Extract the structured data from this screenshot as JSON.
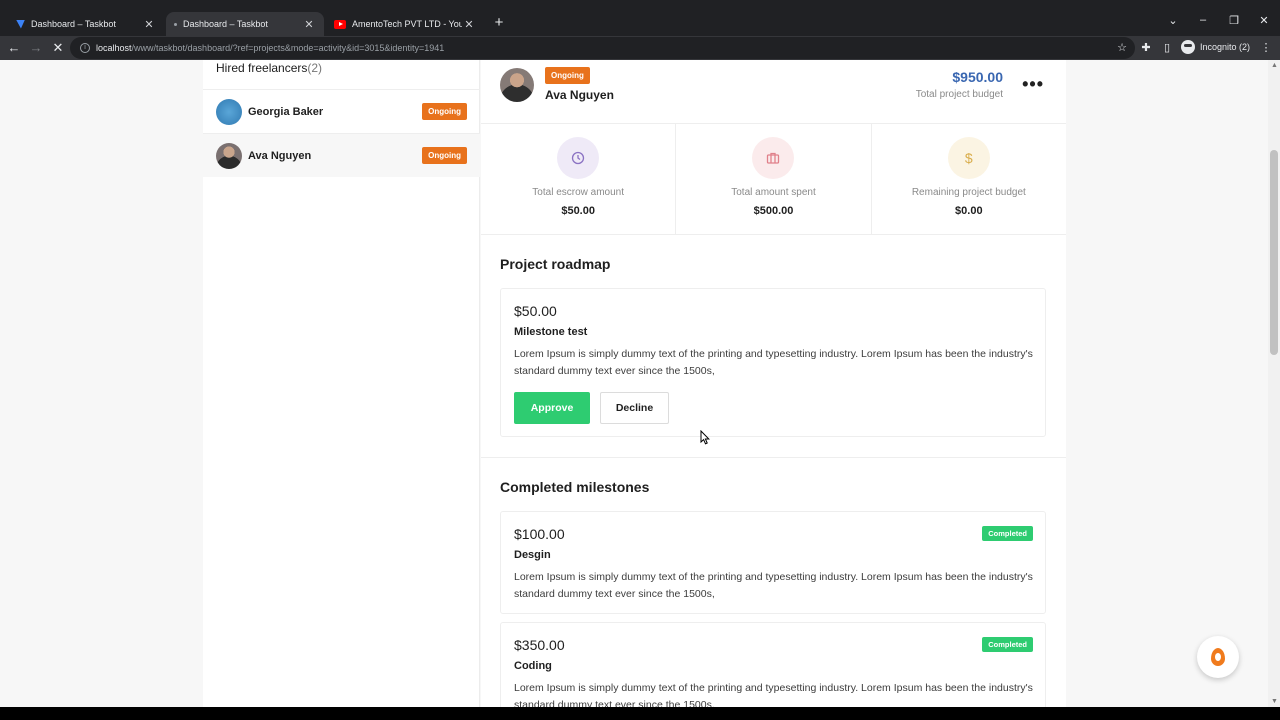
{
  "browser": {
    "tabs": [
      {
        "label": "Dashboard – Taskbot",
        "favicon": "taskbot-icon"
      },
      {
        "label": "Dashboard – Taskbot",
        "favicon": "loading-icon"
      },
      {
        "label": "AmentoTech PVT LTD - YouTube",
        "favicon": "youtube-icon"
      }
    ],
    "url_host": "localhost",
    "url_path": "/www/taskbot/dashboard/?ref=projects&mode=activity&id=3015&identity=1941",
    "profile_label": "Incognito (2)"
  },
  "sidebar": {
    "title": "Hired freelancers",
    "count": "(2)",
    "freelancers": [
      {
        "name": "Georgia Baker",
        "status": "Ongoing"
      },
      {
        "name": "Ava Nguyen",
        "status": "Ongoing"
      }
    ]
  },
  "header": {
    "status": "Ongoing",
    "name": "Ava Nguyen",
    "budget": "$950.00",
    "budget_label": "Total project budget"
  },
  "stats": [
    {
      "label": "Total escrow amount",
      "value": "$50.00",
      "icon": "clock-icon",
      "color": "#8b72c3"
    },
    {
      "label": "Total amount spent",
      "value": "$500.00",
      "icon": "briefcase-icon",
      "color": "#e0808a"
    },
    {
      "label": "Remaining project budget",
      "value": "$0.00",
      "icon": "dollar-icon",
      "color": "#d9ad4c"
    }
  ],
  "roadmap": {
    "title": "Project roadmap",
    "milestone": {
      "amount": "$50.00",
      "title": "Milestone test",
      "description": "Lorem Ipsum is simply dummy text of the printing and typesetting industry. Lorem Ipsum has been the industry's standard dummy text ever since the 1500s,",
      "approve_label": "Approve",
      "decline_label": "Decline"
    }
  },
  "completed": {
    "title": "Completed milestones",
    "items": [
      {
        "amount": "$100.00",
        "title": "Desgin",
        "status": "Completed",
        "description": "Lorem Ipsum is simply dummy text of the printing and typesetting industry. Lorem Ipsum has been the industry's standard dummy text ever since the 1500s,"
      },
      {
        "amount": "$350.00",
        "title": "Coding",
        "status": "Completed",
        "description": "Lorem Ipsum is simply dummy text of the printing and typesetting industry. Lorem Ipsum has been the industry's standard dummy text ever since the 1500s,"
      }
    ]
  },
  "colors": {
    "accent_blue": "#3a67b1",
    "ongoing_orange": "#e8721c",
    "approve_green": "#2ecc71"
  }
}
